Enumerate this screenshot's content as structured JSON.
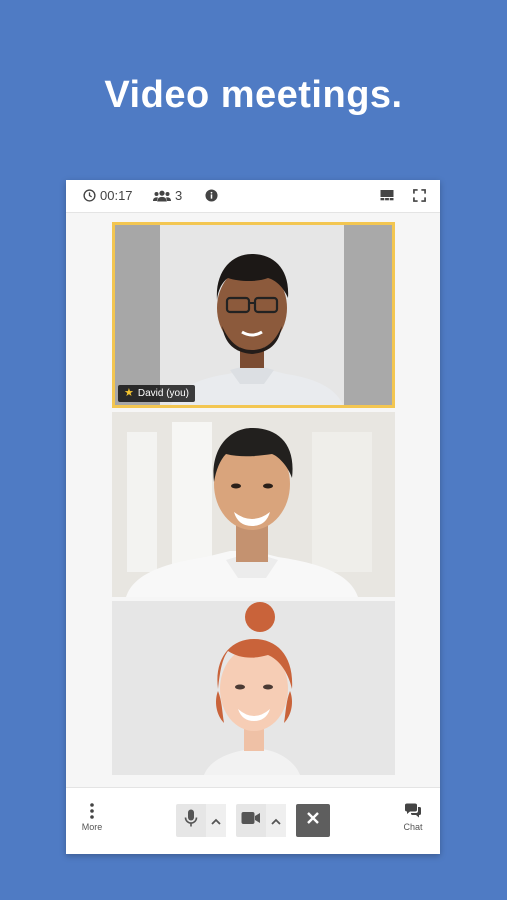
{
  "headline": "Video meetings.",
  "toolbar": {
    "timer": "00:17",
    "participants_count": "3",
    "icons": [
      "clock-icon",
      "participants-icon",
      "info-icon",
      "tile-view-icon",
      "fullscreen-icon"
    ]
  },
  "participants": [
    {
      "name": "David (you)",
      "active": true
    },
    {
      "name": "",
      "active": false
    },
    {
      "name": "",
      "active": false
    }
  ],
  "bottombar": {
    "more_label": "More",
    "chat_label": "Chat",
    "icons": [
      "more-icon",
      "microphone-icon",
      "camera-icon",
      "hangup-icon",
      "chat-icon"
    ]
  },
  "colors": {
    "background": "#4f7bc4",
    "active_border": "#f3c651",
    "hangup": "#5e5e5e"
  }
}
